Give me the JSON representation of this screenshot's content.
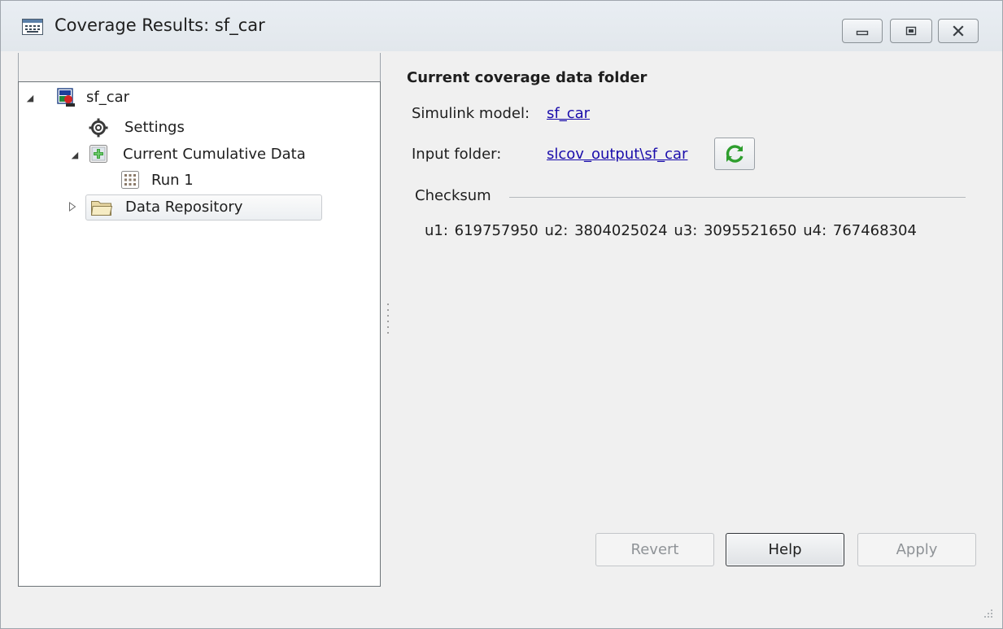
{
  "window": {
    "title": "Coverage Results: sf_car",
    "controls": {
      "minimize": "minimize",
      "maximize": "maximize",
      "close": "close"
    }
  },
  "tree": {
    "items": [
      {
        "label": "sf_car",
        "icon": "model-icon",
        "expanded": true
      },
      {
        "label": "Settings",
        "icon": "gear-icon"
      },
      {
        "label": "Current Cumulative Data",
        "icon": "cumulative-data-icon",
        "expanded": true
      },
      {
        "label": "Run 1",
        "icon": "run-data-icon"
      },
      {
        "label": "Data Repository",
        "icon": "folder-icon",
        "expanded": false,
        "selected": true
      }
    ]
  },
  "details": {
    "heading": "Current coverage data folder",
    "model_label": "Simulink model:",
    "model_value": "sf_car",
    "folder_label": "Input folder:",
    "folder_value": "slcov_output\\sf_car",
    "checksum_label": "Checksum",
    "checksum_values": "u1: 619757950  u2: 3804025024  u3: 3095521650  u4: 767468304"
  },
  "buttons": {
    "revert": "Revert",
    "help": "Help",
    "apply": "Apply"
  },
  "colors": {
    "link": "#1a0dab",
    "window_bg": "#f0f0f0",
    "refresh_green": "#2e9e2e"
  }
}
